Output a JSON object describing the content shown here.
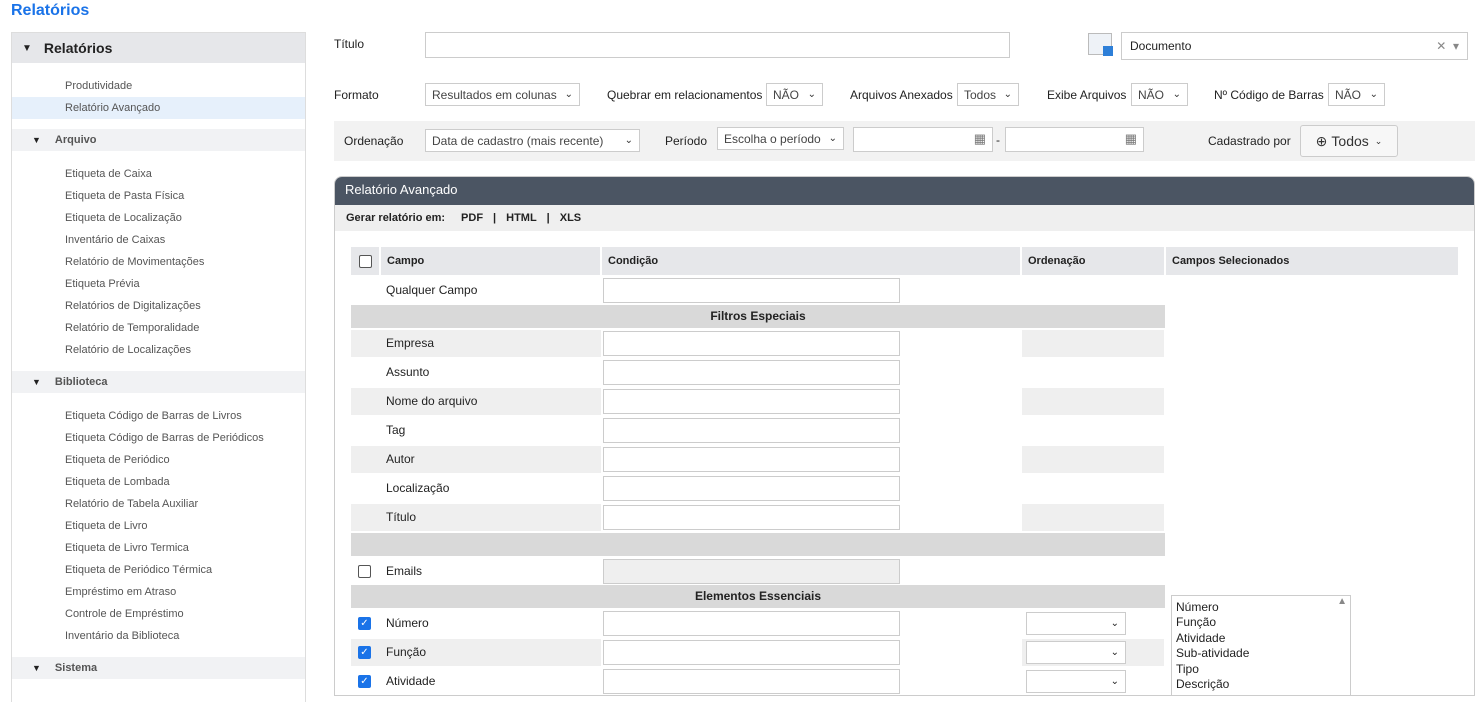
{
  "page_title": "Relatórios",
  "sidebar": {
    "header": "Relatórios",
    "top_items": [
      "Produtividade",
      "Relatório Avançado"
    ],
    "sections": [
      {
        "label": "Arquivo",
        "items": [
          "Etiqueta de Caixa",
          "Etiqueta de Pasta Física",
          "Etiqueta de Localização",
          "Inventário de Caixas",
          "Relatório de Movimentações",
          "Etiqueta Prévia",
          "Relatórios de Digitalizações",
          "Relatório de Temporalidade",
          "Relatório de Localizações"
        ]
      },
      {
        "label": "Biblioteca",
        "items": [
          "Etiqueta Código de Barras de Livros",
          "Etiqueta Código de Barras de Periódicos",
          "Etiqueta de Periódico",
          "Etiqueta de Lombada",
          "Relatório de Tabela Auxiliar",
          "Etiqueta de Livro",
          "Etiqueta de Livro Termica",
          "Etiqueta de Periódico Térmica",
          "Empréstimo em Atraso",
          "Controle de Empréstimo",
          "Inventário da Biblioteca"
        ]
      },
      {
        "label": "Sistema",
        "items": []
      }
    ]
  },
  "form": {
    "titulo_label": "Título",
    "titulo_value": "",
    "doc_type": "Documento",
    "formato_label": "Formato",
    "formato": "Resultados em colunas",
    "quebrar_label": "Quebrar em relacionamentos",
    "quebrar": "NÃO",
    "anexos_label": "Arquivos Anexados",
    "anexos": "Todos",
    "exibe_label": "Exibe Arquivos",
    "exibe": "NÃO",
    "barras_label": "Nº Código de Barras",
    "barras": "NÃO",
    "ordenacao_label": "Ordenação",
    "ordenacao": "Data de cadastro (mais recente)",
    "periodo_label": "Período",
    "periodo": "Escolha o período",
    "dash": "-",
    "cadastrado_label": "Cadastrado por",
    "cadastrado": "Todos"
  },
  "panel": {
    "title": "Relatório Avançado",
    "gerar": "Gerar relatório em:",
    "formats": [
      "PDF",
      "HTML",
      "XLS"
    ],
    "headers": {
      "campo": "Campo",
      "condicao": "Condição",
      "ordenacao": "Ordenação",
      "selecionados": "Campos Selecionados"
    },
    "qualquer": "Qualquer Campo",
    "filtros": "Filtros Especiais",
    "filter_rows": [
      "Empresa",
      "Assunto",
      "Nome do arquivo",
      "Tag",
      "Autor",
      "Localização",
      "Título"
    ],
    "emails": "Emails",
    "essenciais": "Elementos Essenciais",
    "essential_rows": [
      "Número",
      "Função",
      "Atividade"
    ],
    "selected": [
      "Número",
      "Função",
      "Atividade",
      "Sub-atividade",
      "Tipo",
      "Descrição"
    ]
  }
}
